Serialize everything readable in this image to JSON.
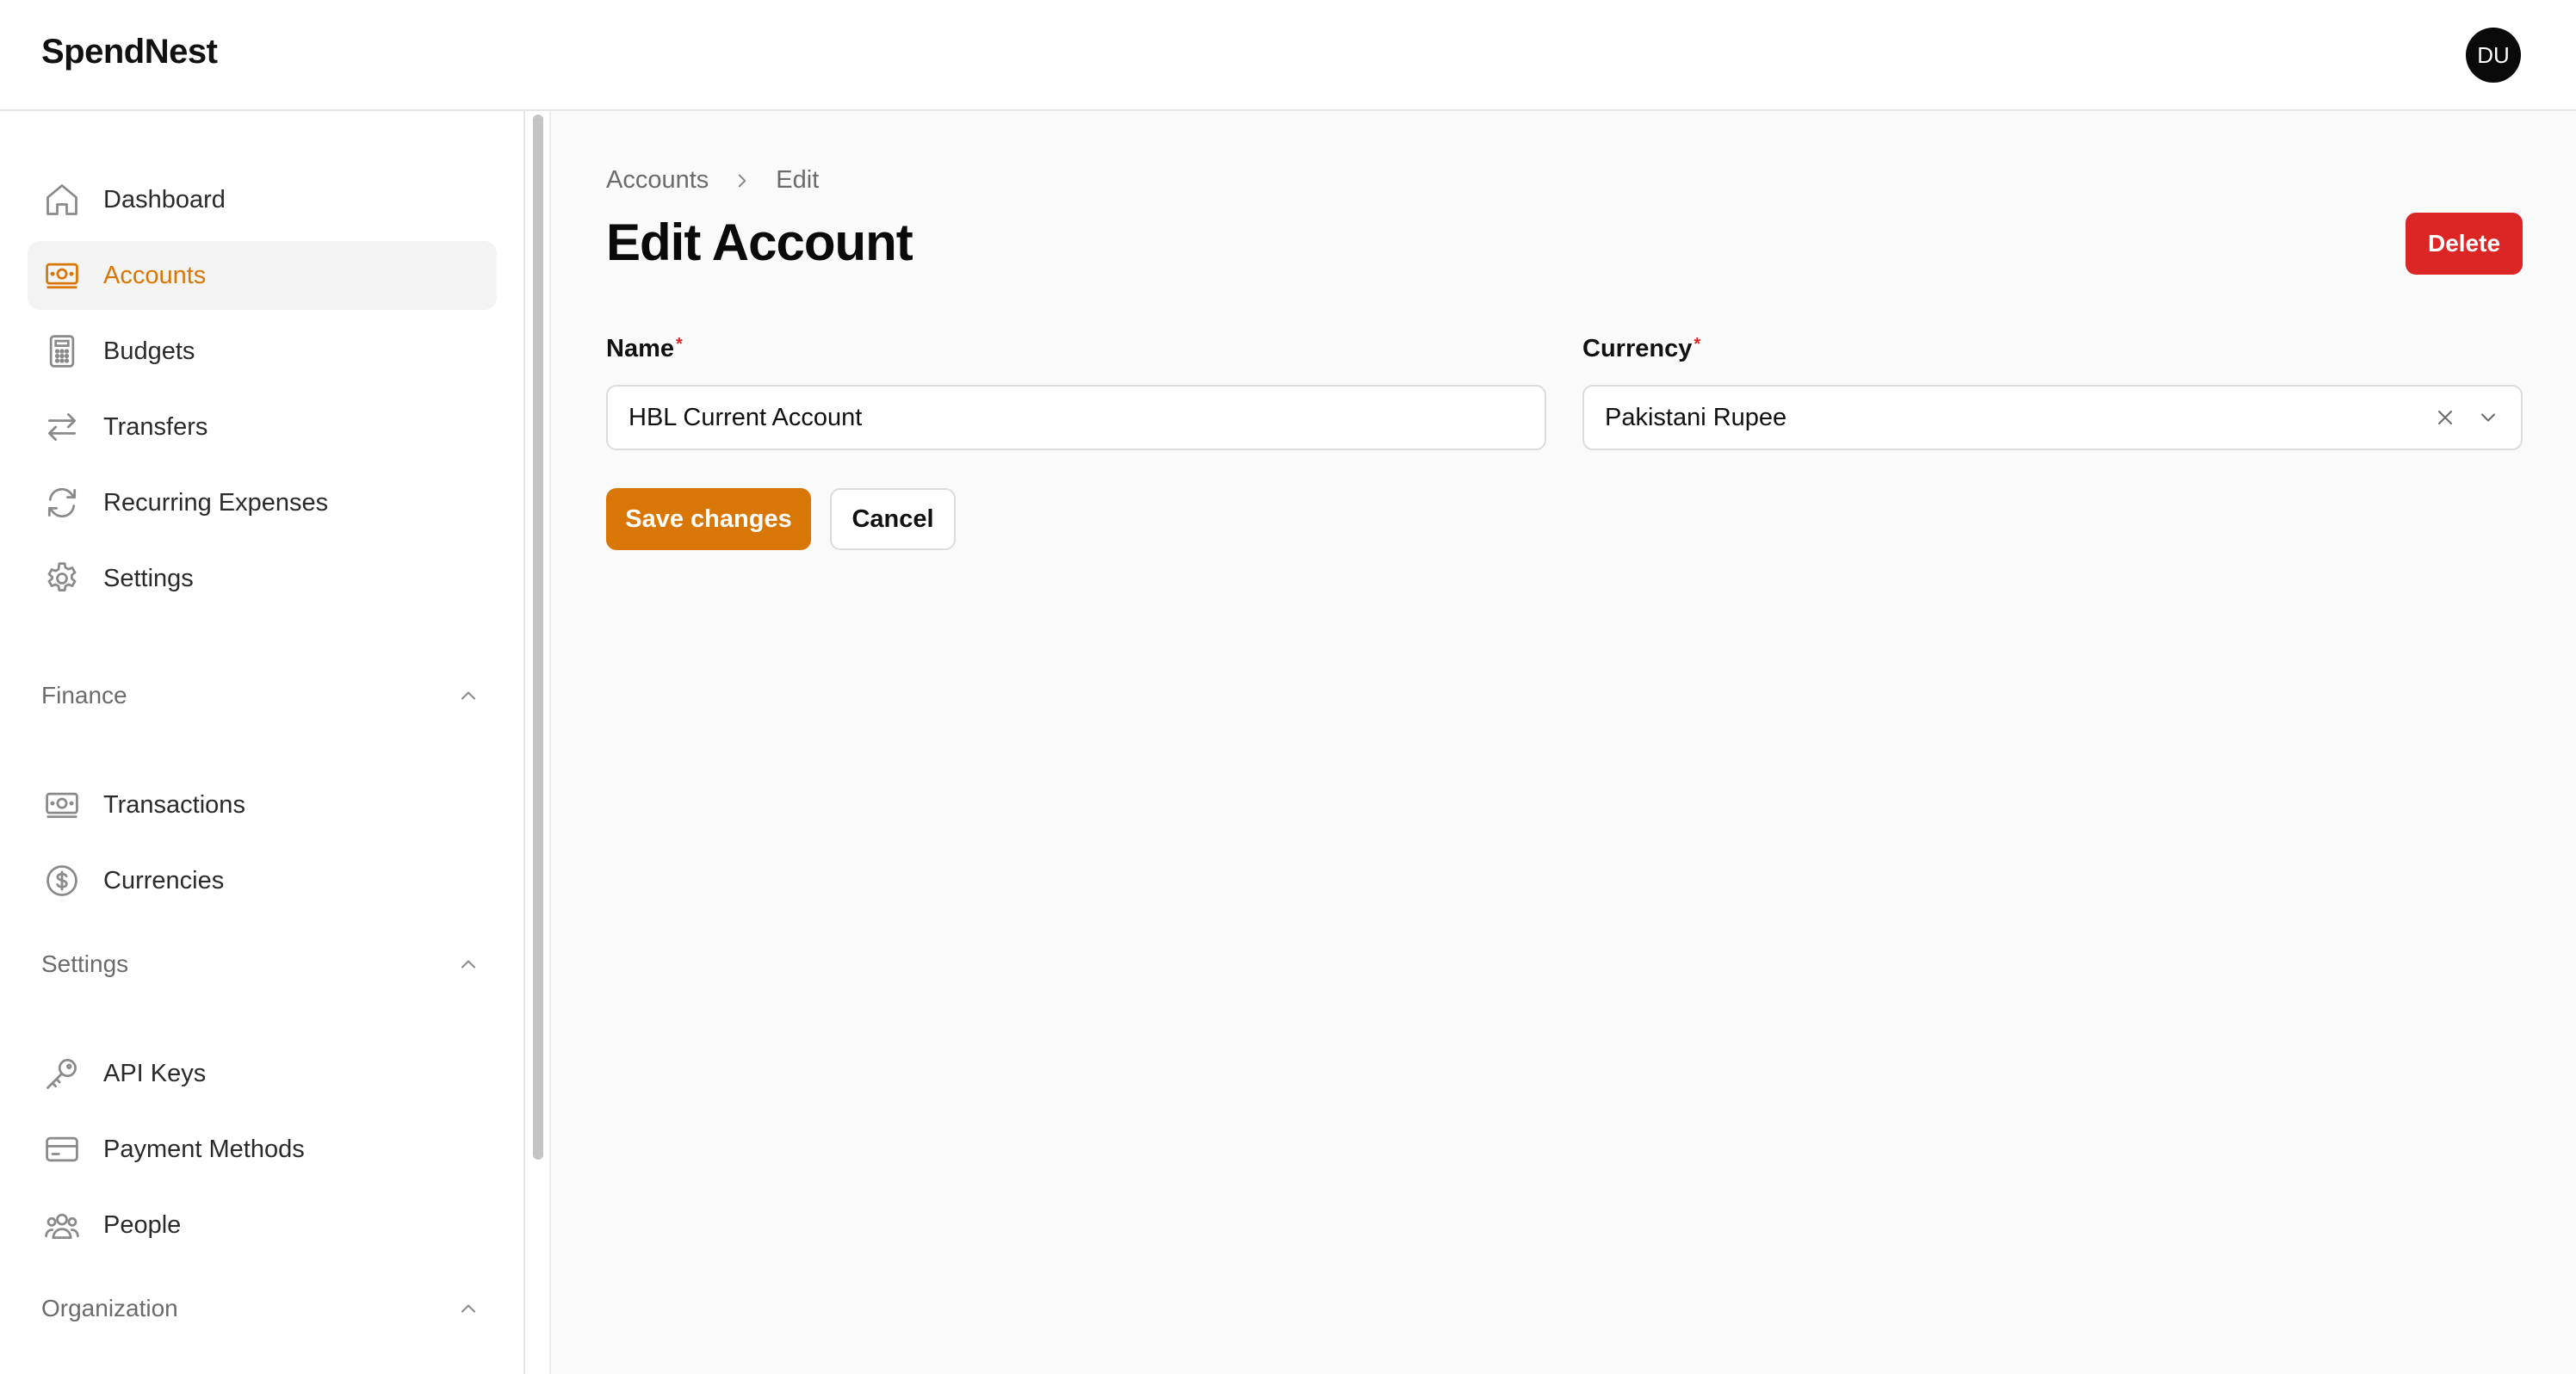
{
  "app": {
    "brand": "SpendNest",
    "user_initials": "DU"
  },
  "colors": {
    "accent": "#d97706",
    "danger": "#dc2626"
  },
  "sidebar": {
    "items": [
      {
        "label": "Dashboard",
        "icon": "home-icon",
        "active": false
      },
      {
        "label": "Accounts",
        "icon": "banknote-icon",
        "active": true
      },
      {
        "label": "Budgets",
        "icon": "calculator-icon",
        "active": false
      },
      {
        "label": "Transfers",
        "icon": "arrows-exchange-icon",
        "active": false
      },
      {
        "label": "Recurring Expenses",
        "icon": "refresh-icon",
        "active": false
      },
      {
        "label": "Settings",
        "icon": "gear-icon",
        "active": false
      }
    ],
    "groups": [
      {
        "title": "Finance",
        "items": [
          {
            "label": "Transactions",
            "icon": "banknote-icon"
          },
          {
            "label": "Currencies",
            "icon": "dollar-circle-icon"
          }
        ]
      },
      {
        "title": "Settings",
        "items": [
          {
            "label": "API Keys",
            "icon": "key-icon"
          },
          {
            "label": "Payment Methods",
            "icon": "credit-card-icon"
          },
          {
            "label": "People",
            "icon": "users-icon"
          }
        ]
      },
      {
        "title": "Organization",
        "items": []
      }
    ]
  },
  "breadcrumb": {
    "parent": "Accounts",
    "current": "Edit"
  },
  "page": {
    "title": "Edit Account",
    "delete_label": "Delete"
  },
  "form": {
    "name": {
      "label": "Name",
      "required_mark": "*",
      "value": "HBL Current Account"
    },
    "currency": {
      "label": "Currency",
      "required_mark": "*",
      "value": "Pakistani Rupee"
    },
    "save_label": "Save changes",
    "cancel_label": "Cancel"
  }
}
